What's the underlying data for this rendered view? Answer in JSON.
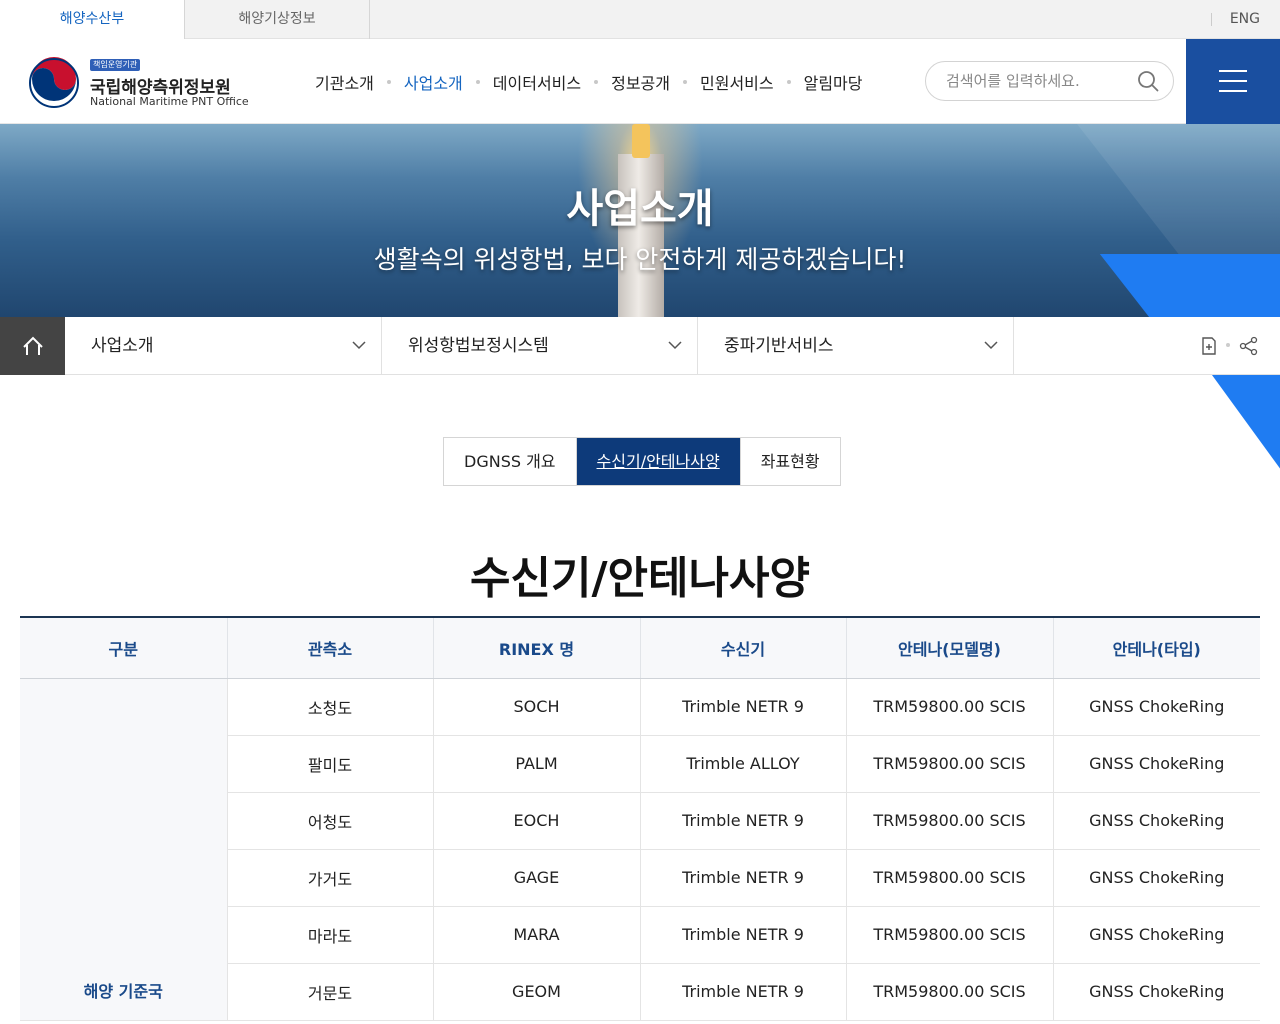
{
  "top_tabs": [
    "해양수산부",
    "해양기상정보"
  ],
  "lang_link": "ENG",
  "logo": {
    "badge": "책임운영기관",
    "name": "국립해양측위정보원",
    "name_en": "National Maritime PNT Office"
  },
  "gnb": [
    "기관소개",
    "사업소개",
    "데이터서비스",
    "정보공개",
    "민원서비스",
    "알림마당"
  ],
  "gnb_active": "사업소개",
  "search": {
    "placeholder": "검색어를 입력하세요."
  },
  "hero": {
    "title": "사업소개",
    "subtitle": "생활속의 위성항법, 보다 안전하게 제공하겠습니다!"
  },
  "location": [
    "사업소개",
    "위성항법보정시스템",
    "중파기반서비스"
  ],
  "subtabs": [
    "DGNSS 개요",
    "수신기/안테나사양",
    "좌표현황"
  ],
  "subtab_active": "수신기/안테나사양",
  "page_title": "수신기/안테나사양",
  "table": {
    "headers": [
      "구분",
      "관측소",
      "RINEX 명",
      "수신기",
      "안테나(모델명)",
      "안테나(타입)"
    ],
    "group": "해양 기준국",
    "rows": [
      [
        "소청도",
        "SOCH",
        "Trimble NETR 9",
        "TRM59800.00 SCIS",
        "GNSS ChokeRing"
      ],
      [
        "팔미도",
        "PALM",
        "Trimble ALLOY",
        "TRM59800.00 SCIS",
        "GNSS ChokeRing"
      ],
      [
        "어청도",
        "EOCH",
        "Trimble NETR 9",
        "TRM59800.00 SCIS",
        "GNSS ChokeRing"
      ],
      [
        "가거도",
        "GAGE",
        "Trimble NETR 9",
        "TRM59800.00 SCIS",
        "GNSS ChokeRing"
      ],
      [
        "마라도",
        "MARA",
        "Trimble NETR 9",
        "TRM59800.00 SCIS",
        "GNSS ChokeRing"
      ],
      [
        "거문도",
        "GEOM",
        "Trimble NETR 9",
        "TRM59800.00 SCIS",
        "GNSS ChokeRing"
      ]
    ]
  },
  "colors": {
    "primary": "#1a4fa0",
    "active_tab": "#0d3a7a",
    "accent": "#1f7cf2",
    "link": "#1565c0"
  }
}
